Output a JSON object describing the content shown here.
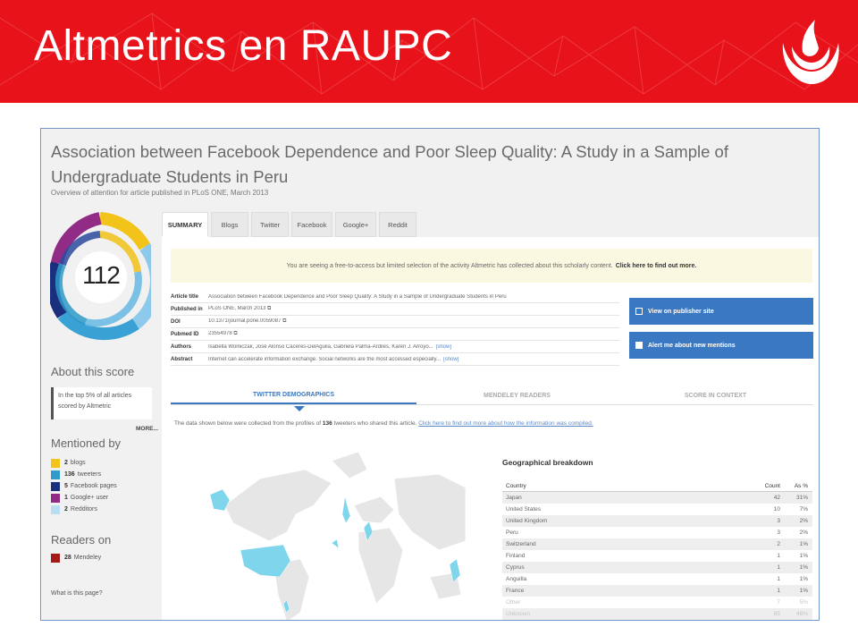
{
  "slide": {
    "title": "Altmetrics en RAUPC",
    "colors": {
      "banner": "#e8121a",
      "accent": "#3a78c2"
    },
    "logo_icon": "upc-logo-icon"
  },
  "article": {
    "title": "Association between Facebook Dependence and Poor Sleep Quality: A Study in a Sample of Undergraduate Students in Peru",
    "subtitle": "Overview of attention for article published in PLoS ONE, March 2013"
  },
  "score": {
    "value": "112",
    "about_heading": "About this score",
    "about_text": "In the top 5% of all articles scored by Altmetric",
    "more": "MORE..."
  },
  "mentioned_by": {
    "heading": "Mentioned by",
    "items": [
      {
        "count": "2",
        "label": "blogs",
        "color": "#f2c318"
      },
      {
        "count": "136",
        "label": "tweeters",
        "color": "#2f9bc9"
      },
      {
        "count": "5",
        "label": "Facebook pages",
        "color": "#1a2f7d"
      },
      {
        "count": "1",
        "label": "Google+ user",
        "color": "#922b86"
      },
      {
        "count": "2",
        "label": "Redditors",
        "color": "#b9def2"
      }
    ]
  },
  "readers": {
    "heading": "Readers on",
    "items": [
      {
        "count": "28",
        "label": "Mendeley",
        "color": "#a41b18"
      }
    ]
  },
  "what_link": "What is this page?",
  "tabs": [
    "SUMMARY",
    "Blogs",
    "Twitter",
    "Facebook",
    "Google+",
    "Reddit"
  ],
  "notice": {
    "text": "You are seeing a free-to-access but limited selection of the activity Altmetric has collected about this scholarly content.",
    "link": "Click here to find out more."
  },
  "meta": [
    {
      "key": "Article title",
      "value": "Association between Facebook Dependence and Poor Sleep Quality: A Study in a Sample of Undergraduate Students in Peru",
      "extra": ""
    },
    {
      "key": "Published in",
      "value": "PLoS ONE, March 2013",
      "extra": ""
    },
    {
      "key": "DOI",
      "value": "10.1371/journal.pone.0059087",
      "extra": ""
    },
    {
      "key": "Pubmed ID",
      "value": "23554978",
      "extra": ""
    },
    {
      "key": "Authors",
      "value": "Isabella Wolniczak, José Alonso Cáceres-DelAguila, Gabriela Palma-Ardiles, Karen J. Arroyo...",
      "extra": "[show]"
    },
    {
      "key": "Abstract",
      "value": "Internet can accelerate information exchange. Social networks are the most accessed especially...",
      "extra": "[show]"
    }
  ],
  "buttons": {
    "publisher": "View on publisher site",
    "alert": "Alert me about new mentions"
  },
  "subtabs": [
    "TWITTER DEMOGRAPHICS",
    "MENDELEY READERS",
    "SCORE IN CONTEXT"
  ],
  "data_line": {
    "prefix": "The data shown below were collected from the profiles of",
    "count": "136",
    "suffix": "tweeters who shared this article.",
    "link": "Click here to find out more about how the information was compiled."
  },
  "geo": {
    "title": "Geographical breakdown",
    "headers": [
      "Country",
      "Count",
      "As %"
    ],
    "rows": [
      [
        "Japan",
        "42",
        "31%"
      ],
      [
        "United States",
        "10",
        "7%"
      ],
      [
        "United Kingdom",
        "3",
        "2%"
      ],
      [
        "Peru",
        "3",
        "2%"
      ],
      [
        "Switzerland",
        "2",
        "1%"
      ],
      [
        "Finland",
        "1",
        "1%"
      ],
      [
        "Cyprus",
        "1",
        "1%"
      ],
      [
        "Anguilla",
        "1",
        "1%"
      ],
      [
        "France",
        "1",
        "1%"
      ],
      [
        "Other",
        "7",
        "5%"
      ],
      [
        "Unknown",
        "65",
        "48%"
      ]
    ]
  }
}
